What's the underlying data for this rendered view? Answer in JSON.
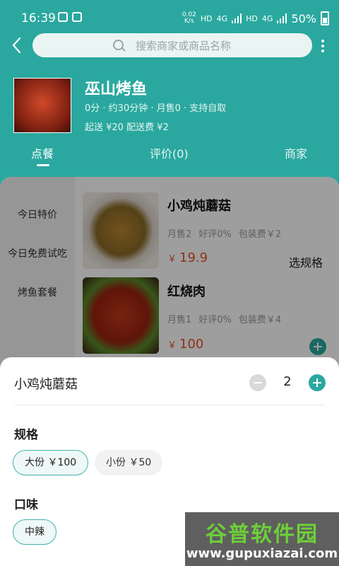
{
  "status_bar": {
    "time": "16:39",
    "net_speed_value": "0.02",
    "net_speed_unit": "K/s",
    "hd1": "HD",
    "net1": "4G",
    "hd2": "HD",
    "net2": "4G",
    "battery": "50%"
  },
  "search": {
    "placeholder": "搜索商家或商品名称"
  },
  "shop": {
    "name": "巫山烤鱼",
    "meta": "0分 · 约30分钟 · 月售0 · 支持自取",
    "fee": "起送 ¥20 配送费 ¥2"
  },
  "tabs": [
    {
      "label": "点餐",
      "active": true
    },
    {
      "label": "评价(0)",
      "active": false
    },
    {
      "label": "商家",
      "active": false
    }
  ],
  "categories": [
    "今日特价",
    "今日免费试吃",
    "烤鱼套餐"
  ],
  "dishes": [
    {
      "name": "小鸡炖蘑菇",
      "sales": "月售2",
      "rating": "好评0%",
      "pack_fee": "包装费￥2",
      "currency": "￥",
      "price": "19.9",
      "action": "选规格"
    },
    {
      "name": "红烧肉",
      "sales": "月售1",
      "rating": "好评0%",
      "pack_fee": "包装费￥4",
      "currency": "￥",
      "price": "100"
    }
  ],
  "sheet": {
    "title": "小鸡炖蘑菇",
    "quantity": "2",
    "spec_title": "规格",
    "specs": [
      {
        "label": "大份 ￥100",
        "selected": true
      },
      {
        "label": "小份 ￥50",
        "selected": false
      }
    ],
    "taste_title": "口味",
    "tastes": [
      {
        "label": "中辣",
        "selected": true
      }
    ]
  },
  "watermark": {
    "big": "谷普软件园",
    "small": "www.gupuxiazai.com"
  },
  "colors": {
    "accent": "#2aa89f",
    "price": "#e8502a"
  }
}
